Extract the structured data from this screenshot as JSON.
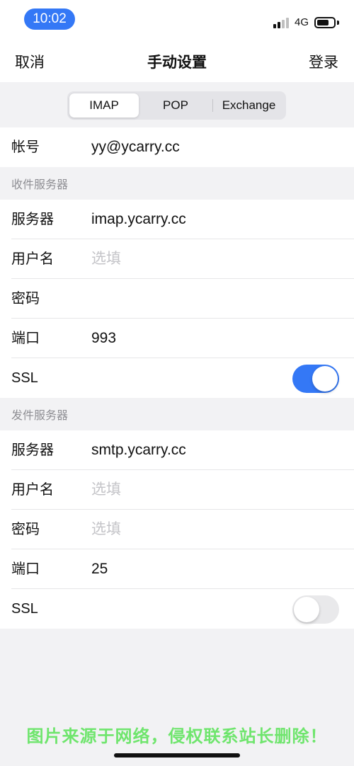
{
  "status_bar": {
    "time": "10:02",
    "network": "4G",
    "icons": [
      "signal-icon",
      "battery-icon"
    ]
  },
  "nav": {
    "cancel_label": "取消",
    "title": "手动设置",
    "login_label": "登录"
  },
  "segments": [
    {
      "label": "IMAP",
      "selected": true
    },
    {
      "label": "POP",
      "selected": false
    },
    {
      "label": "Exchange",
      "selected": false
    }
  ],
  "account": {
    "label": "帐号",
    "value": "yy@ycarry.cc"
  },
  "incoming": {
    "header": "收件服务器",
    "server_label": "服务器",
    "server_value": "imap.ycarry.cc",
    "username_label": "用户名",
    "username_placeholder": "选填",
    "password_label": "密码",
    "port_label": "端口",
    "port_value": "993",
    "ssl_label": "SSL",
    "ssl_on": true
  },
  "outgoing": {
    "header": "发件服务器",
    "server_label": "服务器",
    "server_value": "smtp.ycarry.cc",
    "username_label": "用户名",
    "username_placeholder": "选填",
    "password_label": "密码",
    "password_placeholder": "选填",
    "port_label": "端口",
    "port_value": "25",
    "ssl_label": "SSL",
    "ssl_on": false
  },
  "watermark": "图片来源于网络，侵权联系站长删除！",
  "colors": {
    "accent": "#3478f6",
    "background": "#f2f2f4",
    "placeholder": "#c4c4c8",
    "watermark": "#6fe56d"
  }
}
